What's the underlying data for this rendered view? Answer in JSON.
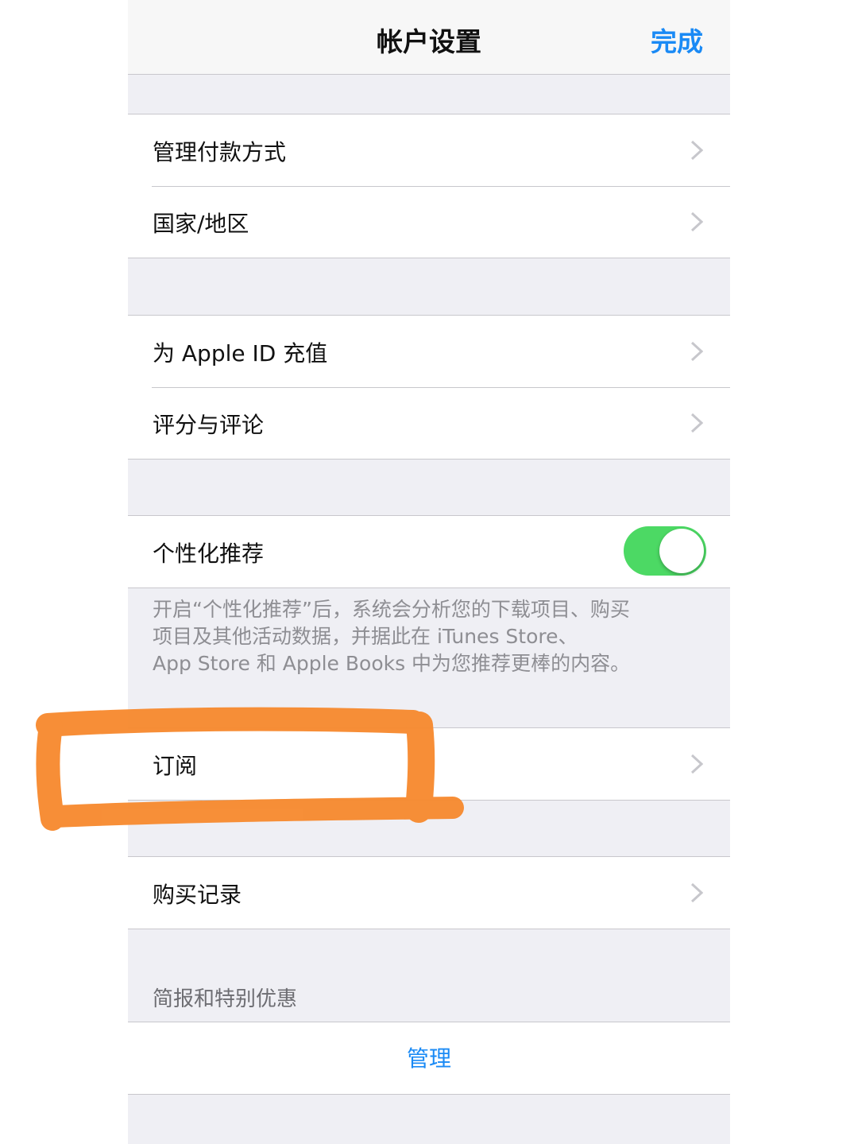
{
  "navbar": {
    "title": "帐户设置",
    "done_label": "完成"
  },
  "groups": {
    "payment": {
      "manage_payment": "管理付款方式",
      "country_region": "国家/地区"
    },
    "balance": {
      "add_funds": "为 Apple ID 充值",
      "ratings_reviews": "评分与评论"
    },
    "personalized": {
      "label": "个性化推荐",
      "toggle_on": true,
      "footnote": [
        "开启“个性化推荐”后，系统会分析您的下载项目、购买",
        "项目及其他活动数据，并据此在 iTunes Store、",
        "App Store 和 Apple Books 中为您推荐更棒的内容。"
      ]
    },
    "subscriptions": {
      "label": "订阅"
    },
    "history": {
      "label": "购买记录"
    },
    "newsletters": {
      "header": "简报和特别优惠",
      "manage_label": "管理"
    }
  },
  "colors": {
    "accent": "#1a8af5",
    "toggle_on": "#4cd964",
    "highlight": "#f7892d",
    "group_bg": "#efeff4"
  },
  "icons": {
    "chevron": "chevron-right-icon"
  }
}
